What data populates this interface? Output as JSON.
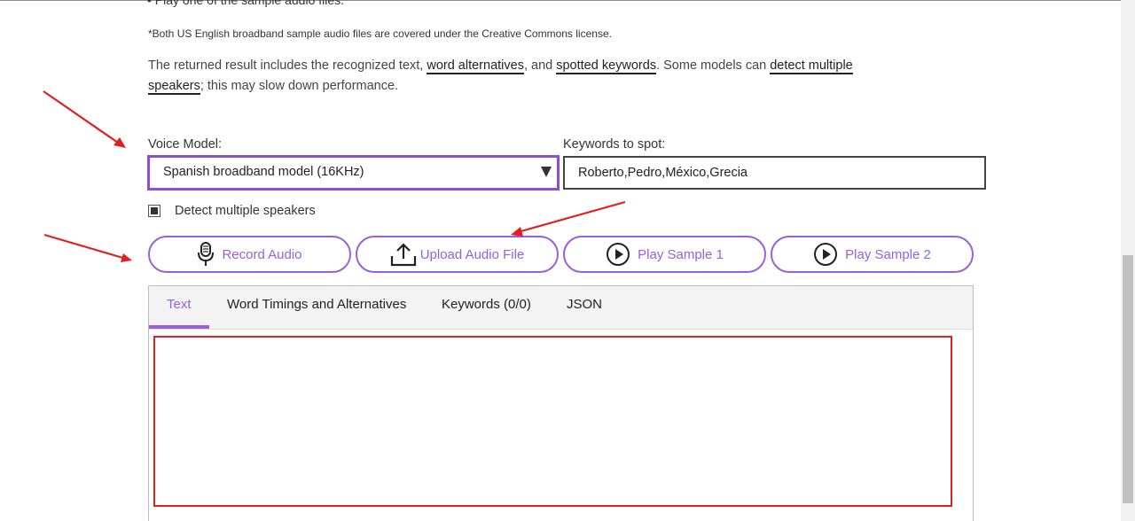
{
  "intro": {
    "bullet": "• Play one of the sample audio files.",
    "license_note": "*Both US English broadband sample audio files are covered under the Creative Commons license.",
    "description": {
      "part1": "The returned result includes the recognized text, ",
      "link_word_alternatives": "word alternatives",
      "part2": ", and ",
      "link_spotted_keywords": "spotted keywords",
      "part3": ". Some models can ",
      "link_detect_multiple": "detect multiple",
      "link_speakers": "speakers",
      "part4": "; this may slow down performance."
    }
  },
  "form": {
    "voice_model_label": "Voice Model:",
    "voice_model_value": "Spanish broadband model (16KHz)",
    "keywords_label": "Keywords to spot:",
    "keywords_value": "Roberto,Pedro,México,Grecia",
    "detect_speakers_label": "Detect multiple speakers",
    "detect_speakers_checked": true
  },
  "buttons": {
    "record_audio": "Record Audio",
    "upload_audio": "Upload Audio File",
    "play_sample_1": "Play Sample 1",
    "play_sample_2": "Play Sample 2"
  },
  "tabs": [
    {
      "label": "Text",
      "active": true
    },
    {
      "label": "Word Timings and Alternatives",
      "active": false
    },
    {
      "label": "Keywords (0/0)",
      "active": false
    },
    {
      "label": "JSON",
      "active": false
    }
  ],
  "colors": {
    "accent": "#9b5fdb",
    "annotation": "#e02020"
  },
  "icons": {
    "record": "microphone-icon",
    "upload": "upload-icon",
    "play": "play-circle-icon",
    "dropdown": "dropdown-arrow-icon"
  }
}
